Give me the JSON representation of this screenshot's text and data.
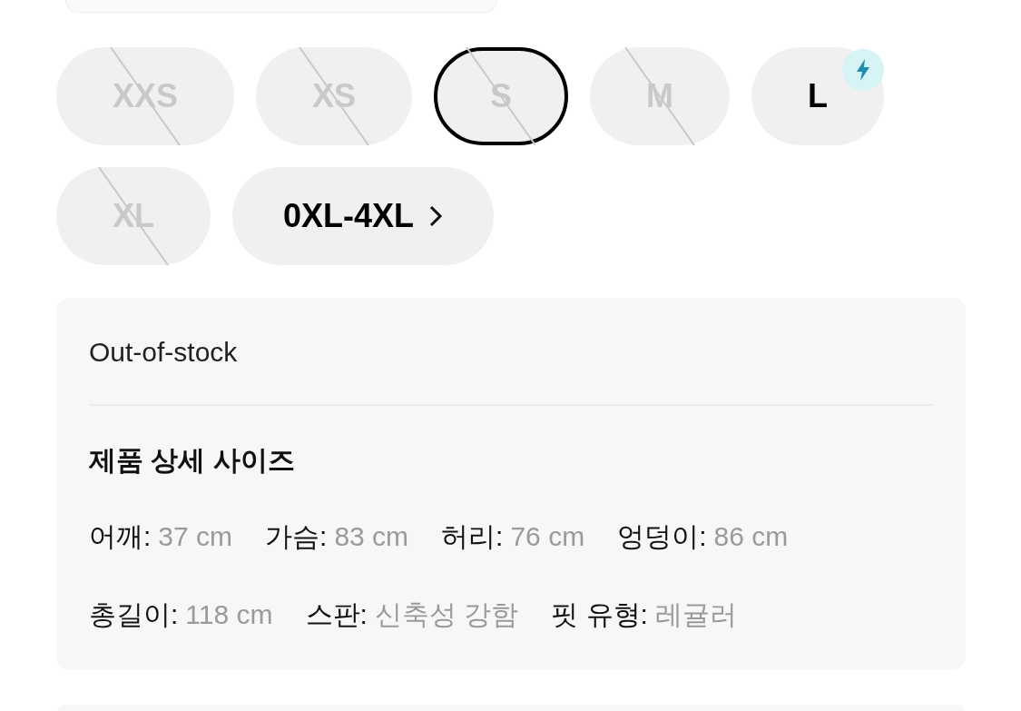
{
  "sizes": [
    {
      "label": "XXS",
      "kind": "size",
      "in_stock": false,
      "selected": false,
      "fast": false
    },
    {
      "label": "XS",
      "kind": "size",
      "in_stock": false,
      "selected": false,
      "fast": false
    },
    {
      "label": "S",
      "kind": "size",
      "in_stock": false,
      "selected": true,
      "fast": false
    },
    {
      "label": "M",
      "kind": "size",
      "in_stock": false,
      "selected": false,
      "fast": false
    },
    {
      "label": "L",
      "kind": "size",
      "in_stock": true,
      "selected": false,
      "fast": true
    },
    {
      "label": "XL",
      "kind": "size",
      "in_stock": false,
      "selected": false,
      "fast": false
    },
    {
      "label": "0XL-4XL",
      "kind": "range",
      "in_stock": true,
      "selected": false,
      "fast": false
    }
  ],
  "info": {
    "status": "Out-of-stock",
    "heading": "제품 상세 사이즈",
    "spec_rows": [
      [
        {
          "label": "어깨:",
          "value": "37 cm"
        },
        {
          "label": "가슴:",
          "value": "83 cm"
        },
        {
          "label": "허리:",
          "value": "76 cm"
        },
        {
          "label": "엉덩이:",
          "value": "86 cm"
        }
      ],
      [
        {
          "label": "총길이:",
          "value": "118 cm"
        },
        {
          "label": "스판:",
          "value": "신축성 강함"
        },
        {
          "label": "핏 유형:",
          "value": "레귤러"
        }
      ]
    ]
  }
}
